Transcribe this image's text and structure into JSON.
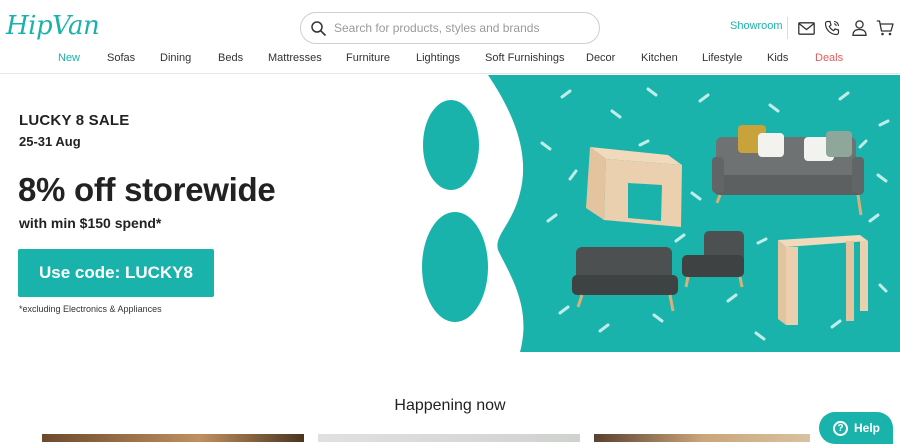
{
  "header": {
    "logo": "HipVan",
    "search_placeholder": "Search for products, styles and brands",
    "showroom": "Showroom",
    "icons": [
      "mail-icon",
      "phone-icon",
      "user-icon",
      "cart-icon"
    ]
  },
  "nav": {
    "items": [
      "New",
      "Sofas",
      "Dining",
      "Beds",
      "Mattresses",
      "Furniture",
      "Lightings",
      "Soft Furnishings",
      "Decor",
      "Kitchen",
      "Lifestyle",
      "Kids",
      "Deals"
    ]
  },
  "hero": {
    "title": "LUCKY 8 SALE",
    "dates": "25-31 Aug",
    "headline": "8% off storewide",
    "subline": "with min $150 spend*",
    "cta": "Use code: LUCKY8",
    "disclaimer": "*excluding Electronics & Appliances",
    "big_numeral": "8"
  },
  "section": {
    "heading": "Happening now"
  },
  "help": {
    "label": "Help",
    "icon": "?"
  },
  "colors": {
    "brand": "#1ab3ab",
    "deals": "#e65a5a",
    "text": "#222222"
  }
}
